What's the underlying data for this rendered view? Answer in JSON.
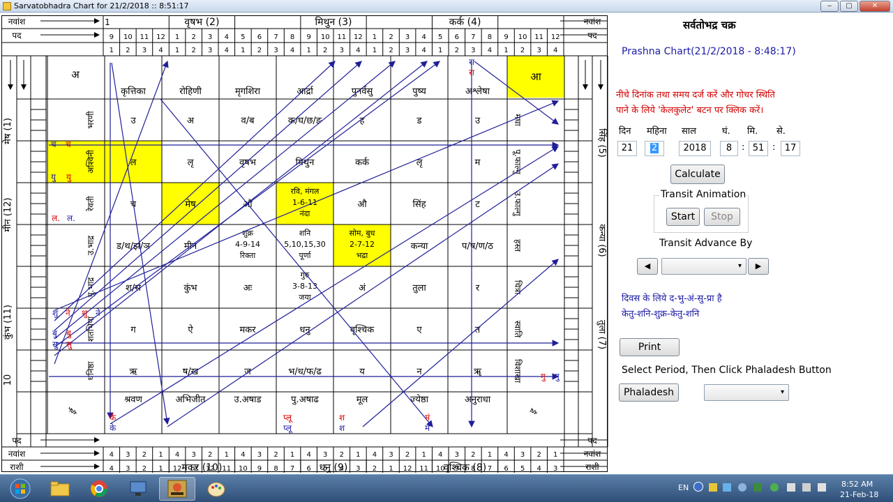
{
  "window": {
    "title": "Sarvatobhadra Chart for 21/2/2018 :: 8:51:17",
    "btn_min": "‒",
    "btn_max": "▢",
    "btn_close": "✕"
  },
  "rashis_top": [
    {
      "t": "वृषभ (2)"
    },
    {
      "t": "मिथुन (3)"
    },
    {
      "t": "कर्क (4)"
    }
  ],
  "rashis_bottom": [
    {
      "t": "मकर (10)"
    },
    {
      "t": "धनु (9)"
    },
    {
      "t": "वृश्चिक (8)"
    }
  ],
  "rashis_left": [
    {
      "t": "मेष (1)"
    },
    {
      "t": "मीन (12)"
    },
    {
      "t": "कुंभ (11)"
    },
    {
      "t": "10"
    }
  ],
  "rashis_right": [
    {
      "t": "सिंह (5)"
    },
    {
      "t": "कन्या (6)"
    },
    {
      "t": "तुला (7)"
    }
  ],
  "corner_labels": {
    "rashi": "राशी",
    "navamsha": "नवांश",
    "pada": "पद"
  },
  "navamsha_top": [
    "9",
    "10",
    "11",
    "12",
    "1",
    "2",
    "3",
    "4",
    "5",
    "6",
    "7",
    "8",
    "9",
    "10",
    "11",
    "12",
    "1",
    "2",
    "3",
    "4",
    "5",
    "6",
    "7",
    "8",
    "9",
    "10",
    "11",
    "12"
  ],
  "navamsha_bottom": [
    "4",
    "3",
    "2",
    "1",
    "12",
    "12",
    "12",
    "11",
    "10",
    "9",
    "8",
    "7",
    "6",
    "5",
    "4",
    "3",
    "2",
    "1",
    "12",
    "11",
    "10",
    "9",
    "8",
    "7",
    "6",
    "5",
    "4",
    "3"
  ],
  "pada_top": [
    "1",
    "2",
    "3",
    "4",
    "1",
    "2",
    "3",
    "4",
    "1",
    "2",
    "3",
    "4",
    "1",
    "2",
    "3",
    "4",
    "1",
    "2",
    "3",
    "4",
    "1",
    "2",
    "3",
    "4",
    "1",
    "2",
    "3",
    "4"
  ],
  "pada_bottom": [
    "4",
    "3",
    "2",
    "1",
    "4",
    "3",
    "2",
    "1",
    "4",
    "3",
    "2",
    "1",
    "4",
    "3",
    "2",
    "1",
    "4",
    "3",
    "2",
    "1",
    "4",
    "3",
    "2",
    "1",
    "4",
    "3",
    "2",
    "1"
  ],
  "top_pada_mark": "1",
  "nak_top": [
    "कृत्तिका",
    "रोहिणी",
    "मृगशिरा",
    "आर्द्रा",
    "पुनर्वसु",
    "पुष्य",
    "अश्लेषा"
  ],
  "nak_bottom": [
    "श्रवण",
    "अभिजीत",
    "उ.अषाड",
    "पु.अषाढ",
    "मूल",
    "ज्येष्ठा",
    "अनुराधा"
  ],
  "nak_left": [
    "भरणी",
    "अश्विनी",
    "रेवती",
    "उ.भाद्र",
    "पु.भाद्र",
    "शतभिषा",
    "धनिष्ठा"
  ],
  "nak_right": [
    "मघा",
    "पू.फाल्गु",
    "उ.फाल्गु",
    "हस्त",
    "चित्रा",
    "स्वाति",
    "विशाखा"
  ],
  "corners": {
    "tl": "अ",
    "tr": "आ",
    "bl": "ई",
    "br": "इ"
  },
  "inner_rows": [
    [
      "उ",
      "अ",
      "व/ब",
      "क/घ/छ/ङ",
      "ह",
      "ड",
      "उ"
    ],
    [
      "ल",
      "लृ",
      "वृषभ",
      "मिथुन",
      "कर्क",
      "लृ",
      "म"
    ],
    [
      "च",
      "मेष",
      "औ",
      "",
      "औ",
      "सिंह",
      "ट"
    ],
    [
      "ड/थ/झ/ञ",
      "मीन",
      "",
      "",
      "",
      "कन्या",
      "प/ष/ण/ठ"
    ],
    [
      "श/स",
      "कुंभ",
      "अः",
      "",
      "अं",
      "तुला",
      "र"
    ],
    [
      "ग",
      "ऐ",
      "मकर",
      "धनु",
      "वृश्चिक",
      "ए",
      "त"
    ],
    [
      "ऋ",
      "ष/ख",
      "ज",
      "भ/ध/फ/ढ",
      "य",
      "न",
      "ॠ"
    ]
  ],
  "tithi_cells": [
    {
      "lines": [
        "रवि, मंगल",
        "1-6-11",
        "नंदा"
      ]
    },
    {
      "lines": [
        "शुक्र",
        "4-9-14",
        "रिक्ता"
      ]
    },
    {
      "lines": [
        "शनि",
        "5,10,15,30",
        "पूर्णा"
      ]
    },
    {
      "lines": [
        "सोम, बुध",
        "2-7-12",
        "भद्रा"
      ]
    },
    {
      "lines": [
        "गुरु",
        "3-8-13",
        "जया"
      ]
    }
  ],
  "planets": [
    {
      "t": "च"
    },
    {
      "t": "च"
    },
    {
      "t": "यु"
    },
    {
      "t": "यु"
    },
    {
      "t": "ल."
    },
    {
      "t": "ल."
    },
    {
      "t": "शु"
    },
    {
      "t": "ने"
    },
    {
      "t": "शु"
    },
    {
      "t": "ने"
    },
    {
      "t": "बु"
    },
    {
      "t": "बु"
    },
    {
      "t": "सु"
    },
    {
      "t": "सु"
    },
    {
      "t": "रा"
    },
    {
      "t": "रा"
    },
    {
      "t": "के"
    },
    {
      "t": "के"
    },
    {
      "t": "प्लू"
    },
    {
      "t": "प्लू"
    },
    {
      "t": "श"
    },
    {
      "t": "श"
    },
    {
      "t": "मं"
    },
    {
      "t": "मं"
    },
    {
      "t": "गु"
    },
    {
      "t": "गु"
    }
  ],
  "colors": {
    "highlight": "#ffff00",
    "line": "#1f1f99",
    "planet_blue": "#1a1aa6",
    "planet_red": "#d40000"
  },
  "panel": {
    "heading": "सर्वतोभद्र चक्र",
    "prashna": "Prashna Chart(21/2/2018 - 8:48:17)",
    "instr1": "नीचे दिनांक तथा समय दर्ज करें और गोचर स्थिति",
    "instr2": "पाने के लिये 'केलकुलेट' बटन पर क्लिक करें।",
    "lbl_day": "दिन",
    "lbl_month": "महिना",
    "lbl_year": "साल",
    "lbl_hour": "घं.",
    "lbl_min": "मि.",
    "lbl_sec": "से.",
    "day": "21",
    "month": "2",
    "year": "2018",
    "hour": "8",
    "min": "51",
    "sec": "17",
    "sep": ":",
    "calculate": "Calculate",
    "transit_anim": "Transit Animation",
    "start": "Start",
    "stop": "Stop",
    "transit_adv": "Transit Advance By",
    "prev": "◀",
    "next": "▶",
    "dd_arrow": "▾",
    "info1": "दिवस के लिये द-भु-अं-सु-प्रा है",
    "info2": "केतु-शनि-शुक्र-केतु-शनि",
    "print": "Print",
    "select_period": "Select Period, Then Click Phaladesh Button",
    "phaladesh": "Phaladesh"
  },
  "taskbar": {
    "lang": "EN",
    "time": "8:52 AM",
    "date": "21-Feb-18"
  }
}
